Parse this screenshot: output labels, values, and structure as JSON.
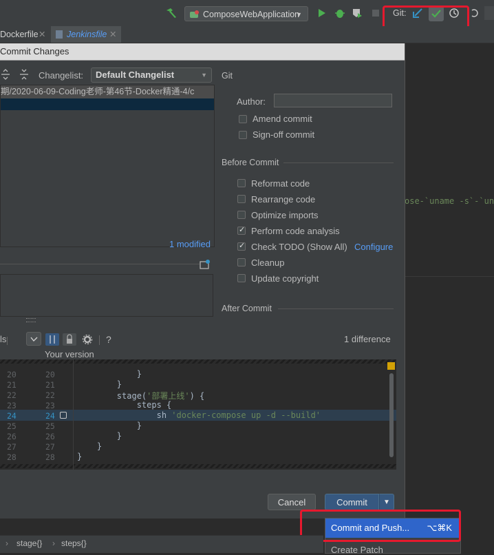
{
  "toolbar": {
    "run_config": "ComposeWebApplication",
    "git_label": "Git:"
  },
  "tabs": [
    {
      "label": "Dockerfile"
    },
    {
      "label": "Jenkinsfile"
    }
  ],
  "editor_bg": {
    "code_fragment": "ose-`uname -s`-`un"
  },
  "dialog": {
    "title": "Commit Changes",
    "changelist_label": "Changelist:",
    "changelist_value": "Default Changelist",
    "path": "期/2020-06-09-Coding老师-第46节-Docker精通-4/c",
    "modified": "1 modified",
    "git_section": "Git",
    "author_label": "Author:",
    "author_value": "",
    "git_options": [
      {
        "label": "Amend commit",
        "checked": false
      },
      {
        "label": "Sign-off commit",
        "checked": false
      }
    ],
    "before_commit_section": "Before Commit",
    "before_options": [
      {
        "label": "Reformat code",
        "checked": false
      },
      {
        "label": "Rearrange code",
        "checked": false
      },
      {
        "label": "Optimize imports",
        "checked": false
      },
      {
        "label": "Perform code analysis",
        "checked": true
      },
      {
        "label": "Check TODO (Show All)",
        "checked": true,
        "link": "Configure"
      },
      {
        "label": "Cleanup",
        "checked": false
      },
      {
        "label": "Update copyright",
        "checked": false
      }
    ],
    "after_commit_section": "After Commit",
    "diff_toolbar_left": "ls",
    "help": "?",
    "differences": "1 difference",
    "your_version": "Your version",
    "diff_lines": [
      {
        "l": "20",
        "r": "20",
        "code": "            }"
      },
      {
        "l": "21",
        "r": "21",
        "code": "        }"
      },
      {
        "l": "22",
        "r": "22",
        "code": "        stage('部署上线') {"
      },
      {
        "l": "23",
        "r": "23",
        "code": "            steps {"
      },
      {
        "l": "24",
        "r": "24",
        "code": "                sh 'docker-compose up -d --build'"
      },
      {
        "l": "25",
        "r": "25",
        "code": "            }"
      },
      {
        "l": "26",
        "r": "26",
        "code": "        }"
      },
      {
        "l": "27",
        "r": "27",
        "code": "    }"
      },
      {
        "l": "28",
        "r": "28",
        "code": "}"
      }
    ],
    "cancel_label": "Cancel",
    "commit_label": "Commit"
  },
  "popup": {
    "item1_label": "Commit and Push...",
    "item1_shortcut": "⌥⌘K",
    "item2_label": "Create Patch"
  },
  "statusbar": {
    "crumb1": "stage{}",
    "crumb2": "steps{}"
  },
  "colors": {
    "accent": "#2f65ca",
    "highlight": "#e6192e",
    "string": "#6a8759",
    "link": "#589df6"
  }
}
